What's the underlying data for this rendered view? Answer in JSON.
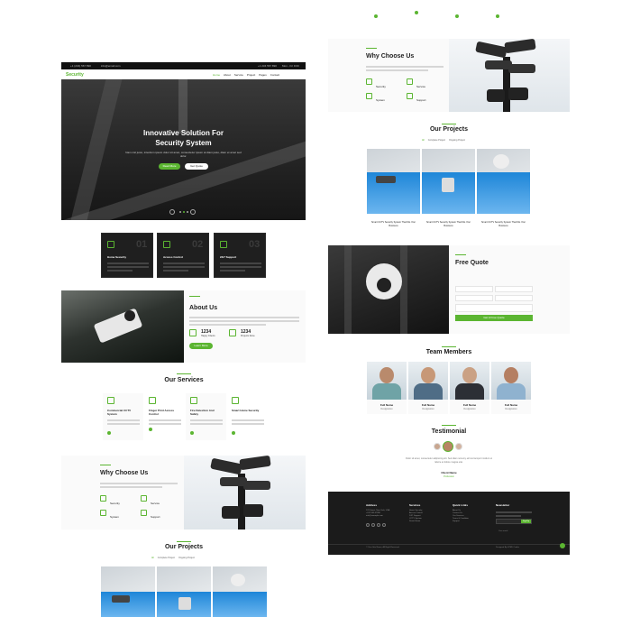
{
  "left": {
    "topbar": {
      "phone": "+1 (234) 567 890",
      "email": "info@email.com",
      "phone2": "+1 234 567 890",
      "hours": "Mon - Fri 9:00"
    },
    "nav": {
      "logo": "Security",
      "items": [
        "Home",
        "About",
        "Service",
        "Project",
        "Pages",
        "Contact"
      ]
    },
    "hero": {
      "title_line1": "Innovative Solution For",
      "title_line2": "Security System",
      "desc": "Nam nisl justo, interdum ipsum dolor sit amet, consectetur ipsum at diam justo, diam et amet sed dolor.",
      "btn1": "Read More",
      "btn2": "Get Quote"
    },
    "features": [
      {
        "num": "01",
        "title": "Home Security"
      },
      {
        "num": "02",
        "title": "Access Control"
      },
      {
        "num": "03",
        "title": "24/7 Support"
      }
    ],
    "about": {
      "title": "About Us",
      "stat1": "1234",
      "stat1_label": "Happy Clients",
      "stat2": "1234",
      "stat2_label": "Projects Done",
      "btn": "Learn More"
    },
    "services_title": "Our Services",
    "services": [
      {
        "title": "Commercial CCTV System"
      },
      {
        "title": "Finger Print Access Control"
      },
      {
        "title": "Fire Detection And Safety"
      },
      {
        "title": "Smart Home Security"
      }
    ],
    "why": {
      "title": "Why Choose Us",
      "items": [
        "Security",
        "Service",
        "System",
        "Support"
      ]
    },
    "projects_title": "Our Projects",
    "project_filters": [
      "All",
      "Complete Project",
      "Ongoing Project"
    ]
  },
  "right": {
    "why": {
      "title": "Why Choose Us",
      "items": [
        "Security",
        "Service",
        "System",
        "Support"
      ]
    },
    "projects_title": "Our Projects",
    "project_filters": [
      "All",
      "Complete Project",
      "Ongoing Project"
    ],
    "projects": [
      {
        "title": "Smart CCTV Security System That Fits Your Business"
      },
      {
        "title": "Smart CCTV Security System That Fits Your Business"
      },
      {
        "title": "Smart CCTV Security System That Fits Your Business"
      }
    ],
    "quote": {
      "title": "Free Quote",
      "fields": [
        "Your Name",
        "Your Email",
        "Your Mobile",
        "Select A Service",
        "Special Note"
      ],
      "btn": "Get A Free Quote"
    },
    "team_title": "Team Members",
    "team": [
      {
        "name": "Full Name",
        "role": "Designation"
      },
      {
        "name": "Full Name",
        "role": "Designation"
      },
      {
        "name": "Full Name",
        "role": "Designation"
      },
      {
        "name": "Full Name",
        "role": "Designation"
      }
    ],
    "testimonial": {
      "title": "Testimonial",
      "text": "Dolor sit amet, consectetur adipiscing elit. Sed diam nonumy eirmod tempor invidunt ut labore et dolore magna erat.",
      "name": "Client Name",
      "role": "Profession"
    },
    "footer": {
      "col1_title": "Address",
      "col1": [
        "123 Street, New York, USA",
        "+012 345 67890",
        "info@example.com"
      ],
      "col2_title": "Services",
      "col2": [
        "Home Security",
        "Access Control",
        "24/7 Support",
        "CCTV System",
        "Smart Home"
      ],
      "col3_title": "Quick Links",
      "col3": [
        "About Us",
        "Contact Us",
        "Our Services",
        "Terms & Condition",
        "Support"
      ],
      "col4_title": "Newsletter",
      "col4_placeholder": "Your email",
      "col4_btn": "SignUp",
      "copyright": "© Your Site Name, All Right Reserved.",
      "credit": "Designed By HTML Codex"
    }
  }
}
